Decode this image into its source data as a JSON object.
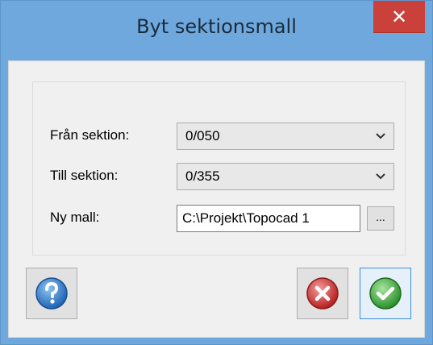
{
  "window": {
    "title": "Byt sektionsmall",
    "close_glyph": "✕"
  },
  "form": {
    "from_label": "Från sektion:",
    "from_value": "0/050",
    "to_label": "Till sektion:",
    "to_value": "0/355",
    "template_label": "Ny mall:",
    "template_value": "C:\\Projekt\\Topocad 1",
    "browse_label": "..."
  },
  "buttons": {
    "help_icon": "help-icon",
    "cancel_icon": "cancel-icon",
    "ok_icon": "ok-check-icon"
  },
  "colors": {
    "titlebar": "#6fa8dc",
    "close": "#c9413a",
    "help": "#2f7fd1",
    "cancel": "#d23a3a",
    "ok": "#3fae3c"
  }
}
